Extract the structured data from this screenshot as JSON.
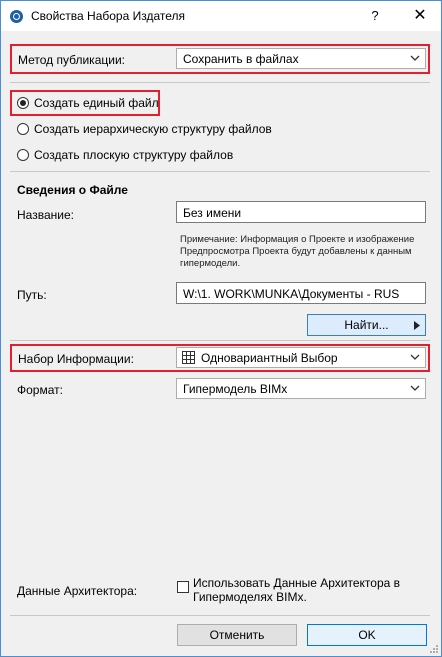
{
  "window": {
    "title": "Свойства Набора Издателя",
    "help": "?",
    "close": "✕"
  },
  "publish": {
    "label": "Метод публикации:",
    "value": "Сохранить в файлах"
  },
  "options": [
    {
      "label": "Создать единый файл",
      "selected": true
    },
    {
      "label": "Создать иерархическую структуру файлов",
      "selected": false
    },
    {
      "label": "Создать плоскую структуру файлов",
      "selected": false
    }
  ],
  "file_info": {
    "heading": "Сведения о Файле",
    "name_label": "Название:",
    "name_value": "Без имени",
    "note": "Примечание: Информация о Проекте и изображение Предпросмотра Проекта будут добавлены к данным гипермодели.",
    "path_label": "Путь:",
    "path_value": "W:\\1. WORK\\MUNKA\\Документы - RUS",
    "find_button": "Найти..."
  },
  "info_set": {
    "label": "Набор Информации:",
    "value": "Одновариантный Выбор"
  },
  "format": {
    "label": "Формат:",
    "value": "Гипермодель BIMx"
  },
  "architect": {
    "label": "Данные Архитектора:",
    "checkbox_label": "Использовать Данные Архитектора в Гипермоделях BIMx.",
    "checked": false
  },
  "buttons": {
    "cancel": "Отменить",
    "ok": "OK"
  },
  "colors": {
    "highlight": "#e0202e",
    "accent": "#0078d7"
  }
}
